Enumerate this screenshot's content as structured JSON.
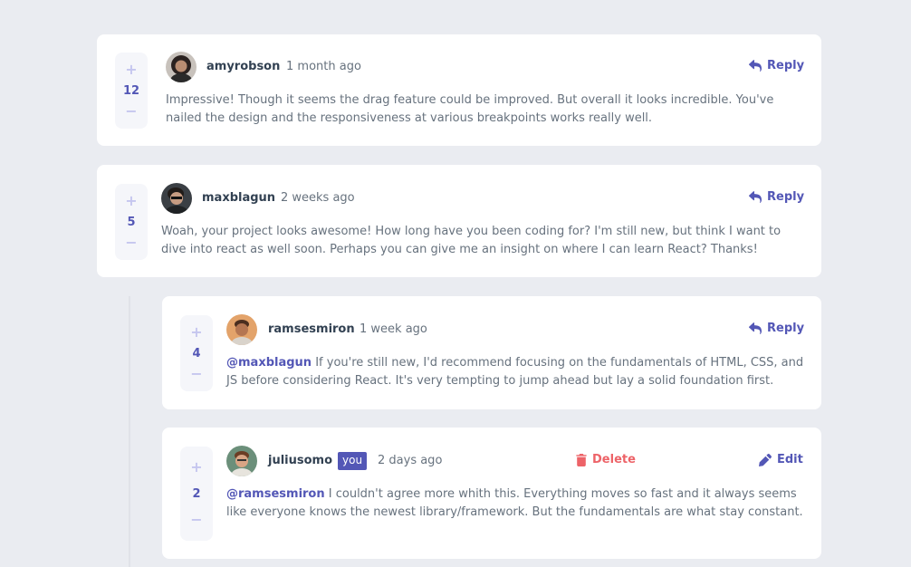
{
  "colors": {
    "background": "#eaecf1",
    "accent": "#5357b6",
    "danger": "#ed6368",
    "card": "#ffffff"
  },
  "comments": [
    {
      "username": "amyrobson",
      "time": "1 month ago",
      "score": "12",
      "plus": "+",
      "minus": "−",
      "action": "Reply",
      "text": "Impressive! Though it seems the drag feature could be improved. But overall it looks incredible. You've nailed the design and the responsiveness at various breakpoints works really well."
    },
    {
      "username": "maxblagun",
      "time": "2 weeks ago",
      "score": "5",
      "plus": "+",
      "minus": "−",
      "action": "Reply",
      "text": "Woah, your project looks awesome! How long have you been coding for? I'm still new, but think I want to dive into react as well soon. Perhaps you can give me an insight on where I can learn React? Thanks!"
    }
  ],
  "replies": [
    {
      "username": "ramsesmiron",
      "time": "1 week ago",
      "score": "4",
      "plus": "+",
      "minus": "−",
      "action": "Reply",
      "mention": "@maxblagun",
      "text": "If you're still new, I'd recommend focusing on the fundamentals of HTML, CSS, and JS before considering React. It's very tempting to jump ahead but lay a solid foundation first."
    },
    {
      "username": "juliusomo",
      "badge": "you",
      "time": "2 days ago",
      "score": "2",
      "plus": "+",
      "minus": "−",
      "delete": "Delete",
      "edit": "Edit",
      "mention": "@ramsesmiron",
      "text": "I couldn't agree more whith this. Everything moves so fast and it always seems like everyone knows the newest library/framework. But the fundamentals are what stay constant."
    }
  ],
  "icons": {
    "reply": "reply-arrow-icon",
    "delete": "trash-icon",
    "edit": "pencil-icon"
  }
}
